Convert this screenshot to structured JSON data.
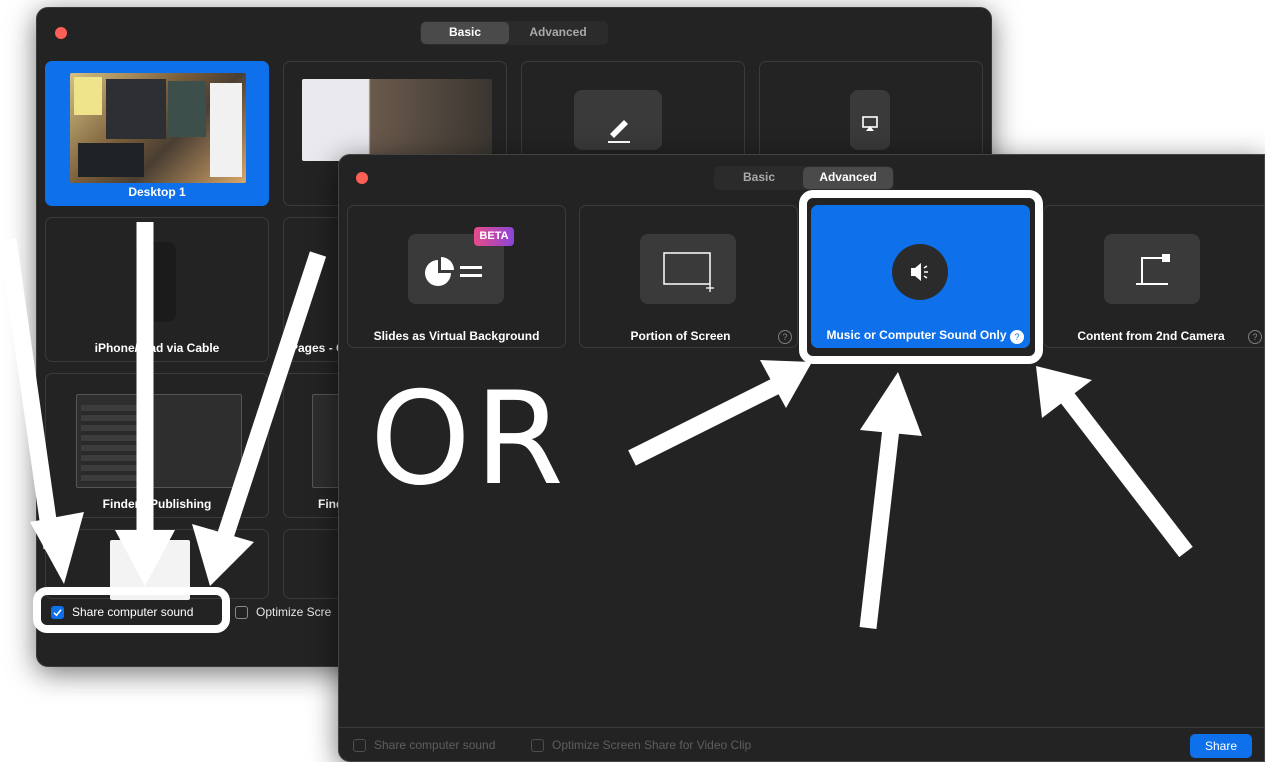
{
  "back_window": {
    "tabs": [
      "Basic",
      "Advanced"
    ],
    "active_tab": "Basic",
    "tiles": [
      {
        "label": "Desktop 1",
        "selected": true
      },
      {
        "label": "",
        "selected": false
      },
      {
        "label": "",
        "icon": "pen-icon"
      },
      {
        "label": "",
        "icon": "airplay-icon"
      },
      {
        "label": "iPhone/iPad via Cable"
      },
      {
        "label": "Pages - C"
      },
      {
        "label": "Finder - Publishing"
      },
      {
        "label": "Find"
      }
    ],
    "share_sound_label": "Share computer sound",
    "share_sound_checked": true,
    "optimize_label": "Optimize Scre"
  },
  "front_window": {
    "tabs": [
      "Basic",
      "Advanced"
    ],
    "active_tab": "Advanced",
    "tiles": [
      {
        "label": "Slides as Virtual Background",
        "badge": "BETA",
        "icon": "slides-icon"
      },
      {
        "label": "Portion of Screen",
        "icon": "portion-screen-icon",
        "help": "?"
      },
      {
        "label": "Music or Computer Sound Only",
        "icon": "speaker-icon",
        "help": "?",
        "selected": true
      },
      {
        "label": "Content from 2nd Camera",
        "icon": "document-camera-icon",
        "help": "?"
      }
    ],
    "share_sound_label": "Share computer sound",
    "optimize_label": "Optimize Screen Share for Video Clip",
    "share_button": "Share"
  },
  "annotation": {
    "or_text": "OR"
  },
  "colors": {
    "accent": "#0e71eb",
    "window_bg": "#232323",
    "tile_border": "#3b3b3b",
    "close": "#fe5f57",
    "annotation": "#ffffff"
  }
}
